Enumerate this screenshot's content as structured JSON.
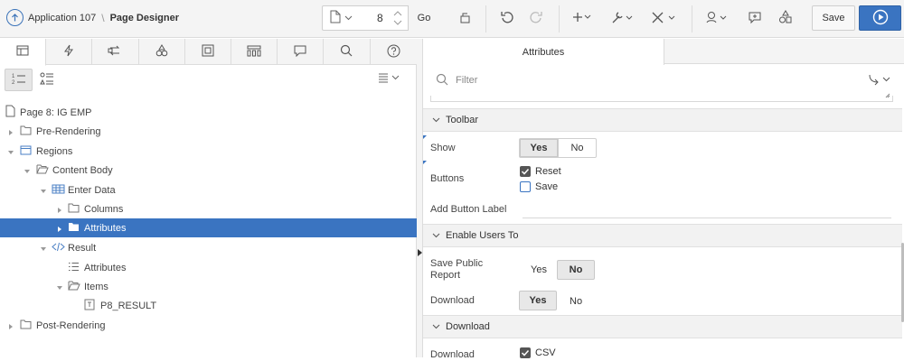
{
  "header": {
    "app_name": "Application 107",
    "separator": "\\",
    "title": "Page Designer",
    "page_number": "8",
    "go_label": "Go",
    "save_label": "Save"
  },
  "left": {
    "tabs": [
      "rendering",
      "dynamic-actions",
      "processing",
      "shared-components",
      "component-view",
      "gallery",
      "comments",
      "search",
      "help"
    ],
    "tree": [
      {
        "label": "Page 8: IG EMP"
      },
      {
        "label": "Pre-Rendering"
      },
      {
        "label": "Regions"
      },
      {
        "label": "Content Body"
      },
      {
        "label": "Enter Data"
      },
      {
        "label": "Columns"
      },
      {
        "label": "Attributes"
      },
      {
        "label": "Result"
      },
      {
        "label": "Attributes"
      },
      {
        "label": "Items"
      },
      {
        "label": "P8_RESULT"
      },
      {
        "label": "Post-Rendering"
      }
    ]
  },
  "right": {
    "tab_label": "Attributes",
    "filter_placeholder": "Filter",
    "toolbar_section": "Toolbar",
    "show_label": "Show",
    "show_yes": "Yes",
    "show_no": "No",
    "buttons_label": "Buttons",
    "reset_label": "Reset",
    "save_label": "Save",
    "add_button_label": "Add Button Label",
    "enable_section": "Enable Users To",
    "save_public_label_1": "Save Public",
    "save_public_label_2": "Report",
    "save_public_yes": "Yes",
    "save_public_no": "No",
    "download_label": "Download",
    "download_yes": "Yes",
    "download_no": "No",
    "download_section": "Download",
    "download_formats_label": "Download",
    "csv_label": "CSV"
  },
  "colors": {
    "accent": "#3a74c1",
    "selected_row": "#3a74c1"
  }
}
